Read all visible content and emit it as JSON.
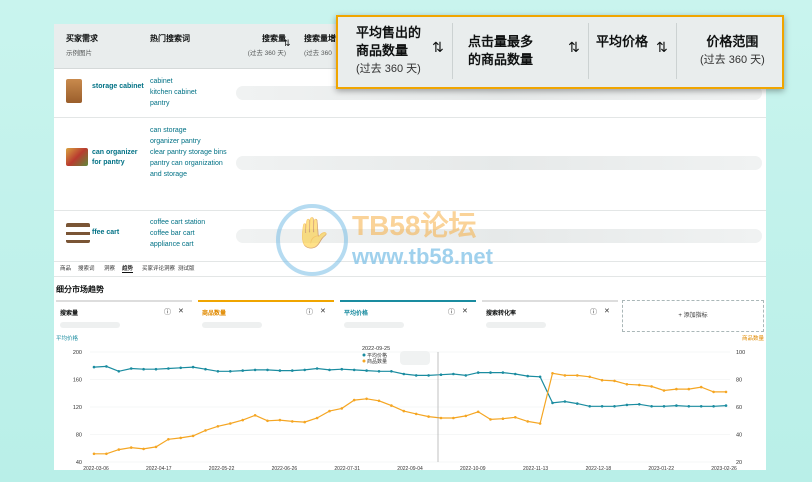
{
  "table": {
    "headers": [
      {
        "label": "买家需求",
        "sub": "示例图片"
      },
      {
        "label": "热门搜索词",
        "sub": ""
      },
      {
        "label": "搜索量",
        "sub": "(过去 360 天)"
      },
      {
        "label": "搜索量增",
        "sub": "(过去 360"
      }
    ],
    "rows": [
      {
        "title": "storage cabinet",
        "keywords": [
          "cabinet",
          "kitchen cabinet",
          "pantry"
        ],
        "thumb_color": "#b5763a"
      },
      {
        "title": "can organizer for pantry",
        "keywords": [
          "can storage",
          "organizer pantry",
          "clear pantry storage bins",
          "pantry can organization and storage"
        ],
        "thumb_color": "#c0483a"
      },
      {
        "title": "ffee cart",
        "keywords": [
          "coffee cart station",
          "coffee bar cart",
          "appliance cart"
        ],
        "thumb_color": "#6b4a2e"
      }
    ]
  },
  "overlay": {
    "columns": [
      {
        "label": "平均售出的 商品数量",
        "sub": "(过去 360 天)"
      },
      {
        "label": "点击量最多 的商品数量",
        "sub": ""
      },
      {
        "label": "平均价格",
        "sub": ""
      },
      {
        "label": "价格范围",
        "sub": "(过去 360 天)"
      }
    ]
  },
  "tabs": [
    "商品",
    "搜索词",
    "洞察",
    "趋势",
    "买家评论洞察",
    "测试版"
  ],
  "active_tab": "趋势",
  "section_title": "细分市场趋势",
  "metrics": [
    {
      "label": "搜索量",
      "color": "#dddddd"
    },
    {
      "label": "商品数量",
      "color": "#f0a500"
    },
    {
      "label": "平均价格",
      "color": "#1a8ca0"
    },
    {
      "label": "搜索转化率",
      "color": "#dddddd"
    }
  ],
  "add_metric": "+ 添加指标",
  "watermark": {
    "brand": "TB58论坛",
    "url": "www.tb58.net"
  },
  "chart_data": {
    "type": "line",
    "left_axis_label": "平均价格",
    "right_axis_label": "商品数量",
    "left_ticks": [
      40,
      80,
      120,
      160,
      200
    ],
    "right_ticks": [
      20,
      40,
      60,
      80,
      100
    ],
    "left_range": [
      40,
      200
    ],
    "right_range": [
      20,
      100
    ],
    "x_ticks": [
      "2022-03-06",
      "2022-04-17",
      "2022-05-22",
      "2022-06-26",
      "2022-07-31",
      "2022-09-04",
      "2022-10-09",
      "2022-11-13",
      "2022-12-18",
      "2023-01-22",
      "2023-02-26"
    ],
    "tooltip": {
      "date": "2022-09-25",
      "items": [
        "平均价格",
        "商品数量"
      ]
    },
    "series": [
      {
        "name": "平均价格",
        "color": "#1a8ca0",
        "axis": "left",
        "values": [
          178,
          179,
          172,
          176,
          175,
          175,
          176,
          177,
          178,
          175,
          172,
          172,
          173,
          174,
          174,
          173,
          173,
          174,
          176,
          174,
          175,
          174,
          173,
          172,
          172,
          168,
          166,
          166,
          167,
          168,
          166,
          170,
          170,
          170,
          168,
          165,
          164,
          126,
          128,
          125,
          121,
          121,
          121,
          123,
          124,
          121,
          121,
          122,
          121,
          121,
          121,
          122
        ]
      },
      {
        "name": "商品数量",
        "color": "#f5a623",
        "axis": "left",
        "values": [
          52,
          52,
          58,
          61,
          59,
          62,
          73,
          75,
          78,
          86,
          92,
          96,
          101,
          108,
          100,
          101,
          99,
          98,
          104,
          114,
          118,
          130,
          132,
          129,
          122,
          114,
          110,
          106,
          104,
          104,
          107,
          113,
          102,
          103,
          105,
          99,
          96,
          169,
          166,
          166,
          164,
          159,
          158,
          153,
          152,
          150,
          144,
          146,
          146,
          149,
          142,
          142
        ]
      }
    ]
  }
}
